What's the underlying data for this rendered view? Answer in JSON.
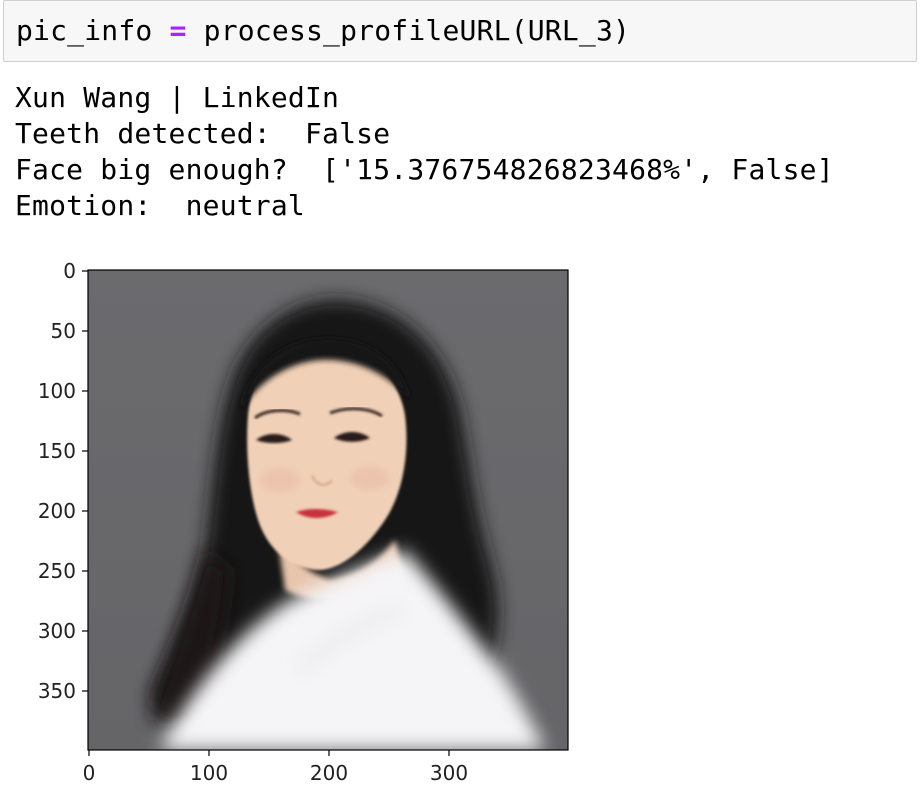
{
  "input_cell": {
    "var_name": "pic_info",
    "operator": "=",
    "call": "process_profileURL(URL_3)"
  },
  "output": {
    "lines": [
      "Xun Wang | LinkedIn",
      "Teeth detected:  False",
      "Face big enough?  ['15.376754826823468%', False]",
      "Emotion:  neutral"
    ]
  },
  "plot": {
    "image_subject": "profile-photo",
    "y_ticks": [
      "0",
      "50",
      "100",
      "150",
      "200",
      "250",
      "300",
      "350"
    ],
    "x_ticks": [
      "0",
      "100",
      "200",
      "300"
    ],
    "colors": {
      "background": "#6a6a6d",
      "hair": "#161213",
      "skin": "#efcfb6",
      "shirt": "#f4f3f5",
      "lips": "#c8303a"
    }
  }
}
